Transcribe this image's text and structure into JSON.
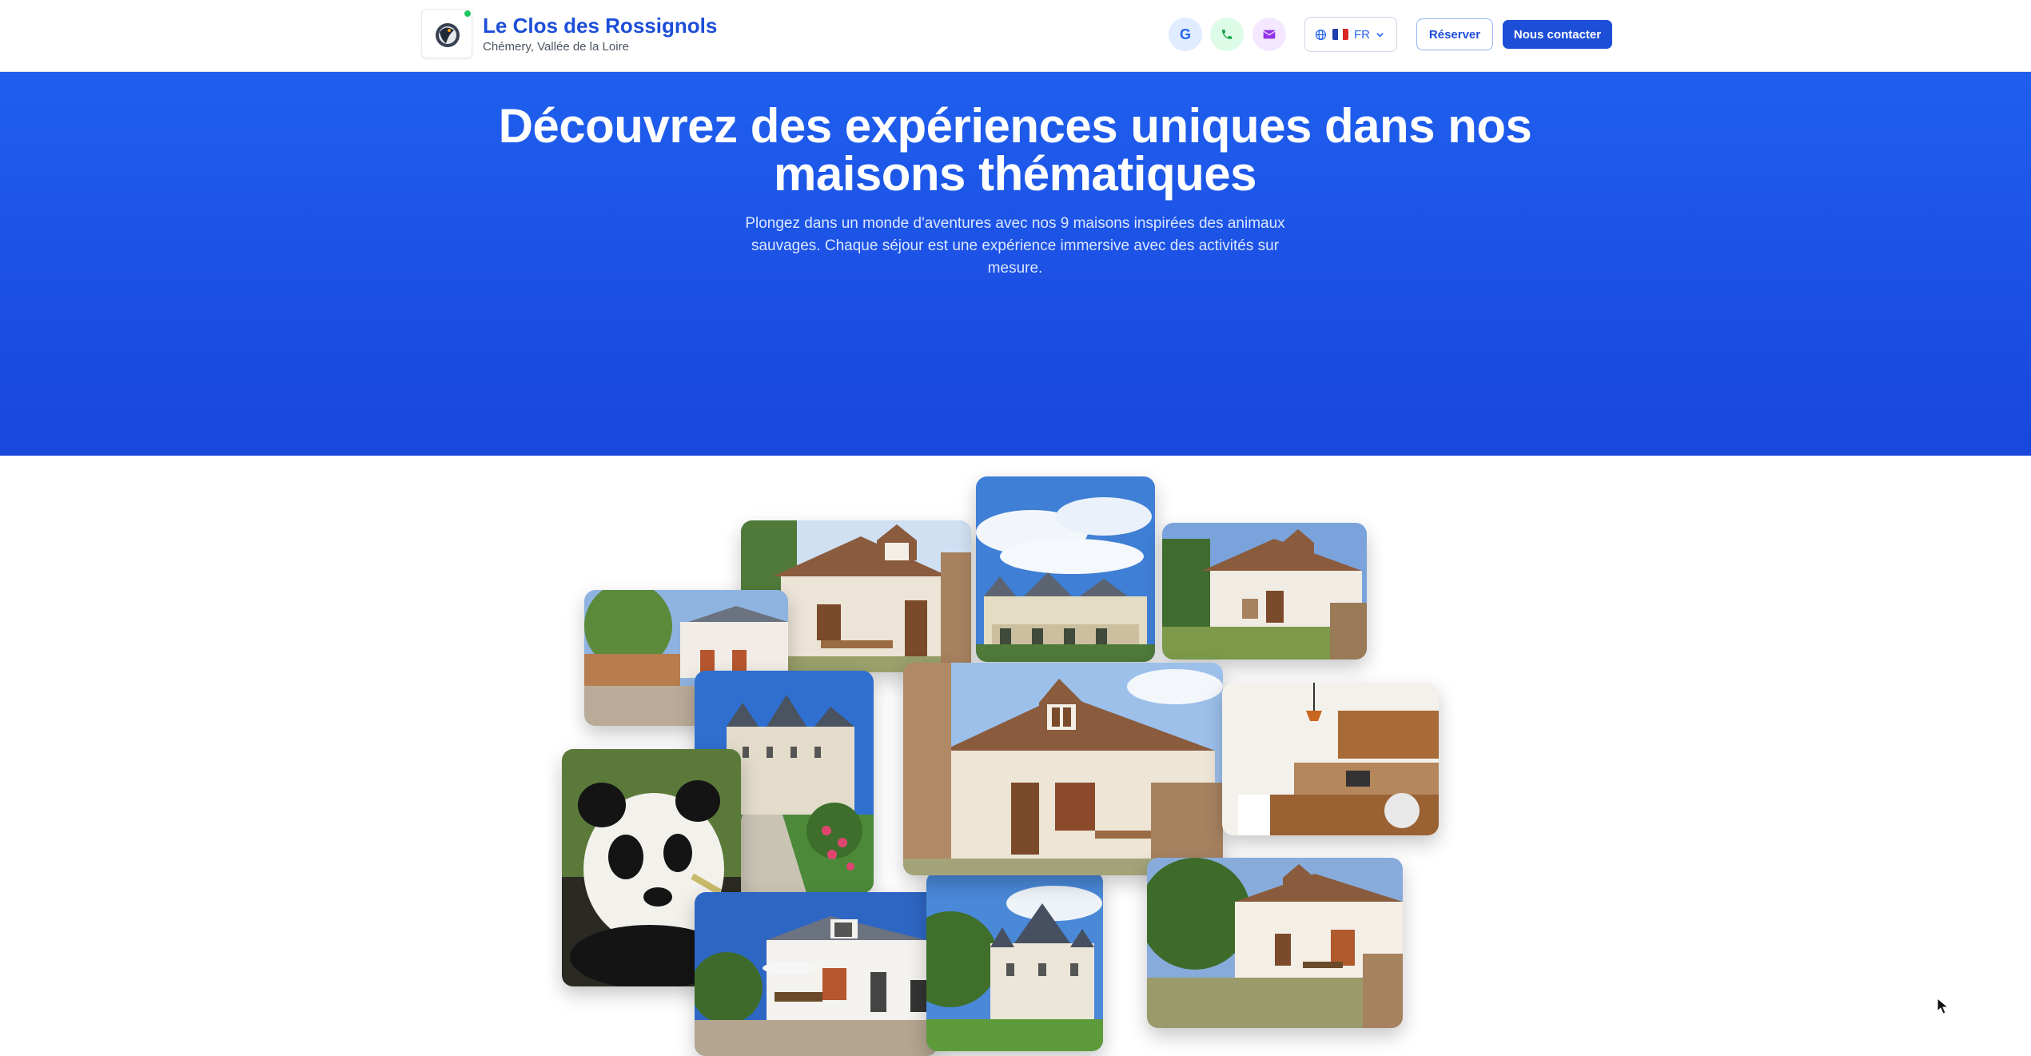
{
  "header": {
    "brand_title": "Le Clos des Rossignols",
    "brand_subtitle": "Chémery, Vallée de la Loire",
    "google_label": "G",
    "language": "FR",
    "reserve_label": "Réserver",
    "contact_label": "Nous contacter",
    "icons": [
      "logo-bird-icon",
      "google-icon",
      "phone-icon",
      "mail-icon",
      "globe-icon",
      "french-flag-icon",
      "chevron-down-icon"
    ]
  },
  "hero": {
    "title": "Découvrez des expériences uniques dans nos maisons thématiques",
    "subtitle": "Plongez dans un monde d'aventures avec nos 9 maisons inspirées des animaux sauvages. Chaque séjour est une expérience immersive avec des activités sur mesure."
  },
  "gallery": {
    "photos": [
      "cottage-front-photo",
      "chateau-chenonceau-photo",
      "cottage-garden-photo",
      "cottage-courtyard-photo",
      "chateau-chambord-photo",
      "cottage-center-photo",
      "kitchen-photo",
      "panda-photo",
      "villa-terrace-photo",
      "chateau-cheverny-photo",
      "cottage-yard-photo"
    ]
  },
  "colors": {
    "brand_blue": "#1d4ed8",
    "hero_blue": "#1f5fee",
    "online_green": "#22c55e"
  }
}
